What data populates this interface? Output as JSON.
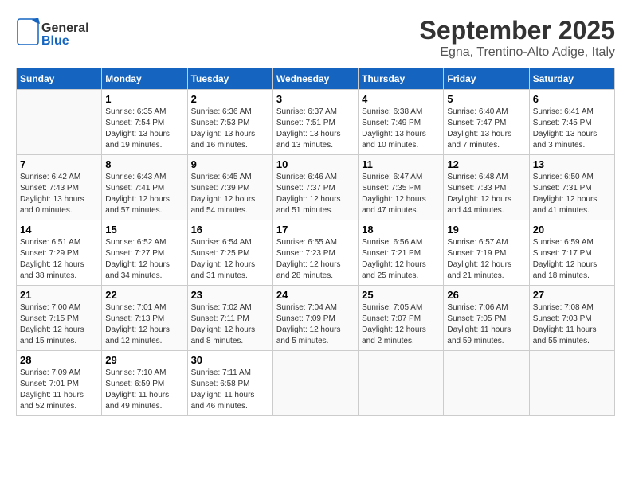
{
  "logo": {
    "text_general": "General",
    "text_blue": "Blue"
  },
  "title": "September 2025",
  "subtitle": "Egna, Trentino-Alto Adige, Italy",
  "days_of_week": [
    "Sunday",
    "Monday",
    "Tuesday",
    "Wednesday",
    "Thursday",
    "Friday",
    "Saturday"
  ],
  "weeks": [
    [
      {
        "day": "",
        "info": ""
      },
      {
        "day": "1",
        "info": "Sunrise: 6:35 AM\nSunset: 7:54 PM\nDaylight: 13 hours\nand 19 minutes."
      },
      {
        "day": "2",
        "info": "Sunrise: 6:36 AM\nSunset: 7:53 PM\nDaylight: 13 hours\nand 16 minutes."
      },
      {
        "day": "3",
        "info": "Sunrise: 6:37 AM\nSunset: 7:51 PM\nDaylight: 13 hours\nand 13 minutes."
      },
      {
        "day": "4",
        "info": "Sunrise: 6:38 AM\nSunset: 7:49 PM\nDaylight: 13 hours\nand 10 minutes."
      },
      {
        "day": "5",
        "info": "Sunrise: 6:40 AM\nSunset: 7:47 PM\nDaylight: 13 hours\nand 7 minutes."
      },
      {
        "day": "6",
        "info": "Sunrise: 6:41 AM\nSunset: 7:45 PM\nDaylight: 13 hours\nand 3 minutes."
      }
    ],
    [
      {
        "day": "7",
        "info": "Sunrise: 6:42 AM\nSunset: 7:43 PM\nDaylight: 13 hours\nand 0 minutes."
      },
      {
        "day": "8",
        "info": "Sunrise: 6:43 AM\nSunset: 7:41 PM\nDaylight: 12 hours\nand 57 minutes."
      },
      {
        "day": "9",
        "info": "Sunrise: 6:45 AM\nSunset: 7:39 PM\nDaylight: 12 hours\nand 54 minutes."
      },
      {
        "day": "10",
        "info": "Sunrise: 6:46 AM\nSunset: 7:37 PM\nDaylight: 12 hours\nand 51 minutes."
      },
      {
        "day": "11",
        "info": "Sunrise: 6:47 AM\nSunset: 7:35 PM\nDaylight: 12 hours\nand 47 minutes."
      },
      {
        "day": "12",
        "info": "Sunrise: 6:48 AM\nSunset: 7:33 PM\nDaylight: 12 hours\nand 44 minutes."
      },
      {
        "day": "13",
        "info": "Sunrise: 6:50 AM\nSunset: 7:31 PM\nDaylight: 12 hours\nand 41 minutes."
      }
    ],
    [
      {
        "day": "14",
        "info": "Sunrise: 6:51 AM\nSunset: 7:29 PM\nDaylight: 12 hours\nand 38 minutes."
      },
      {
        "day": "15",
        "info": "Sunrise: 6:52 AM\nSunset: 7:27 PM\nDaylight: 12 hours\nand 34 minutes."
      },
      {
        "day": "16",
        "info": "Sunrise: 6:54 AM\nSunset: 7:25 PM\nDaylight: 12 hours\nand 31 minutes."
      },
      {
        "day": "17",
        "info": "Sunrise: 6:55 AM\nSunset: 7:23 PM\nDaylight: 12 hours\nand 28 minutes."
      },
      {
        "day": "18",
        "info": "Sunrise: 6:56 AM\nSunset: 7:21 PM\nDaylight: 12 hours\nand 25 minutes."
      },
      {
        "day": "19",
        "info": "Sunrise: 6:57 AM\nSunset: 7:19 PM\nDaylight: 12 hours\nand 21 minutes."
      },
      {
        "day": "20",
        "info": "Sunrise: 6:59 AM\nSunset: 7:17 PM\nDaylight: 12 hours\nand 18 minutes."
      }
    ],
    [
      {
        "day": "21",
        "info": "Sunrise: 7:00 AM\nSunset: 7:15 PM\nDaylight: 12 hours\nand 15 minutes."
      },
      {
        "day": "22",
        "info": "Sunrise: 7:01 AM\nSunset: 7:13 PM\nDaylight: 12 hours\nand 12 minutes."
      },
      {
        "day": "23",
        "info": "Sunrise: 7:02 AM\nSunset: 7:11 PM\nDaylight: 12 hours\nand 8 minutes."
      },
      {
        "day": "24",
        "info": "Sunrise: 7:04 AM\nSunset: 7:09 PM\nDaylight: 12 hours\nand 5 minutes."
      },
      {
        "day": "25",
        "info": "Sunrise: 7:05 AM\nSunset: 7:07 PM\nDaylight: 12 hours\nand 2 minutes."
      },
      {
        "day": "26",
        "info": "Sunrise: 7:06 AM\nSunset: 7:05 PM\nDaylight: 11 hours\nand 59 minutes."
      },
      {
        "day": "27",
        "info": "Sunrise: 7:08 AM\nSunset: 7:03 PM\nDaylight: 11 hours\nand 55 minutes."
      }
    ],
    [
      {
        "day": "28",
        "info": "Sunrise: 7:09 AM\nSunset: 7:01 PM\nDaylight: 11 hours\nand 52 minutes."
      },
      {
        "day": "29",
        "info": "Sunrise: 7:10 AM\nSunset: 6:59 PM\nDaylight: 11 hours\nand 49 minutes."
      },
      {
        "day": "30",
        "info": "Sunrise: 7:11 AM\nSunset: 6:58 PM\nDaylight: 11 hours\nand 46 minutes."
      },
      {
        "day": "",
        "info": ""
      },
      {
        "day": "",
        "info": ""
      },
      {
        "day": "",
        "info": ""
      },
      {
        "day": "",
        "info": ""
      }
    ]
  ]
}
